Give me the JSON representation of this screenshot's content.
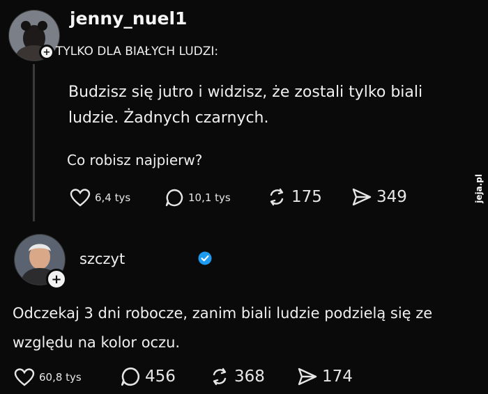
{
  "post1": {
    "username": "jenny_nuel1",
    "header_text": "TYLKO DLA BIAŁYCH LUDZI:",
    "body_line1": "Budzisz się jutro i widzisz, że zostali tylko biali",
    "body_line2": "ludzie. Żadnych czarnych.",
    "question": "Co robisz najpierw?",
    "likes": "6,4 tys",
    "comments": "10,1 tys",
    "reposts": "175",
    "shares": "349"
  },
  "post2": {
    "username": "szczyt",
    "body_line1": "Odczekaj 3 dni robocze, zanim biali ludzie podzielą się ze",
    "body_line2": "względu na kolor oczu.",
    "likes": "60,8 tys",
    "comments": "456",
    "reposts": "368",
    "shares": "174"
  },
  "watermark": "jeja.pl",
  "colors": {
    "verified": "#1d9bf0",
    "background": "#0a0a0a",
    "text": "#f2f2f2",
    "watermark_dot": "#e02020"
  }
}
